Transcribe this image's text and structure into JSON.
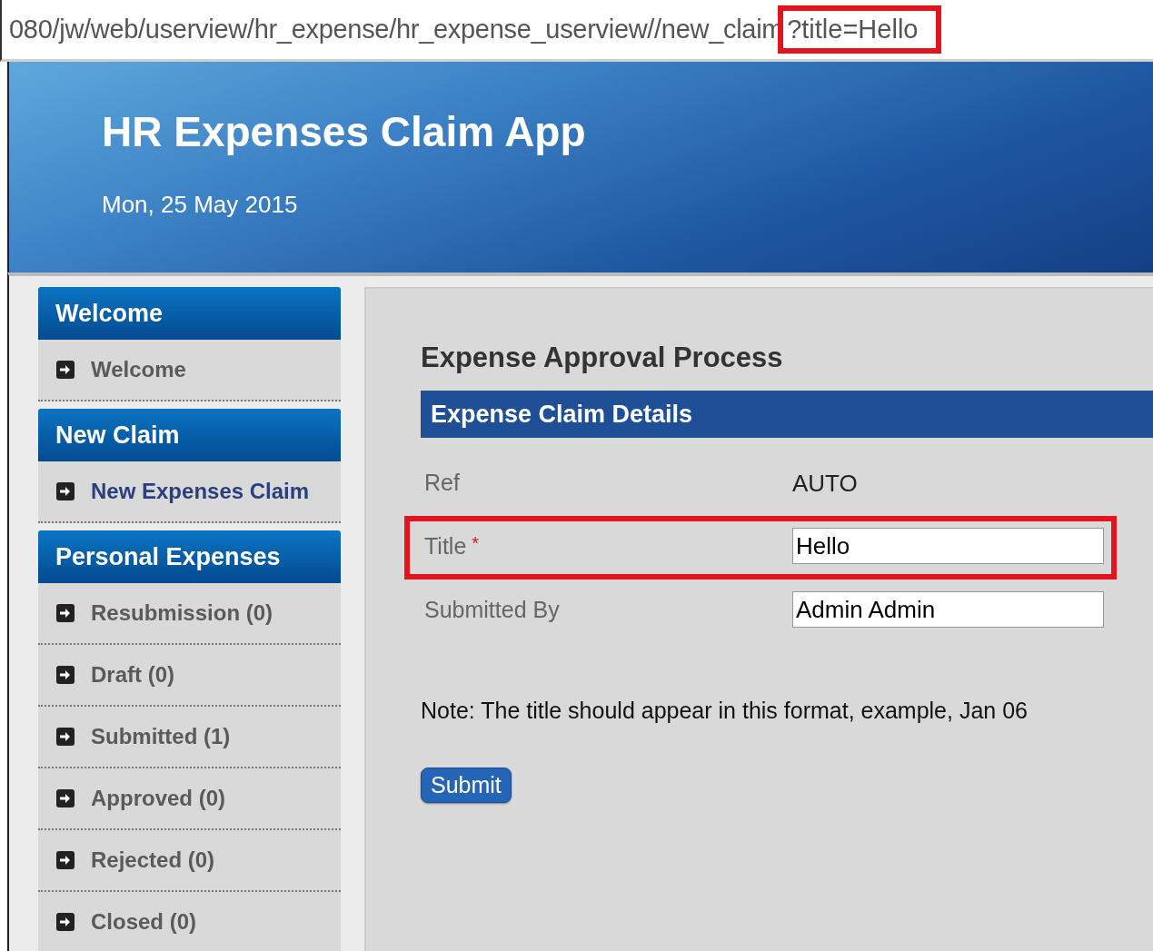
{
  "address_bar": {
    "url": "080/jw/web/userview/hr_expense/hr_expense_userview//new_claim",
    "query": "?title=Hello",
    "query_highlighted": true
  },
  "header": {
    "title": "HR Expenses Claim App",
    "date": "Mon, 25 May 2015"
  },
  "sidebar": {
    "sections": [
      {
        "title": "Welcome",
        "items": [
          {
            "label": "Welcome",
            "selected": false
          }
        ]
      },
      {
        "title": "New Claim",
        "items": [
          {
            "label": "New Expenses Claim",
            "selected": true
          }
        ]
      },
      {
        "title": "Personal Expenses",
        "items": [
          {
            "label": "Resubmission (0)",
            "selected": false
          },
          {
            "label": "Draft (0)",
            "selected": false
          },
          {
            "label": "Submitted (1)",
            "selected": false
          },
          {
            "label": "Approved (0)",
            "selected": false
          },
          {
            "label": "Rejected (0)",
            "selected": false
          },
          {
            "label": "Closed (0)",
            "selected": false
          }
        ]
      }
    ]
  },
  "form": {
    "heading": "Expense Approval Process",
    "section_title": "Expense Claim Details",
    "fields": [
      {
        "kind": "static",
        "label": "Ref",
        "value": "AUTO",
        "highlighted": false
      },
      {
        "kind": "input",
        "label": "Title",
        "value": "Hello",
        "required_mark": "*",
        "highlighted": true
      },
      {
        "kind": "input",
        "label": "Submitted By",
        "value": "Admin Admin",
        "highlighted": false
      }
    ],
    "note": "Note: The title should appear in this format, example, Jan 06",
    "submit": "Submit"
  }
}
